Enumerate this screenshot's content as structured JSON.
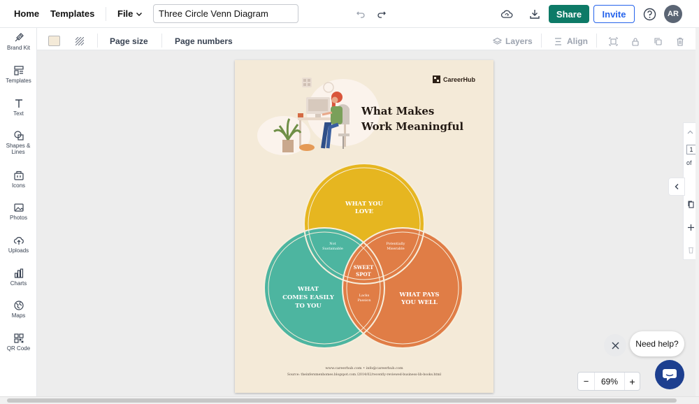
{
  "topbar": {
    "home": "Home",
    "templates": "Templates",
    "file": "File",
    "doc_title": "Three Circle Venn Diagram",
    "share": "Share",
    "invite": "Invite",
    "avatar": "AR"
  },
  "sidebar": {
    "items": [
      {
        "label": "Brand Kit",
        "icon": "brand-kit-icon"
      },
      {
        "label": "Templates",
        "icon": "templates-icon"
      },
      {
        "label": "Text",
        "icon": "text-icon"
      },
      {
        "label": "Shapes & Lines",
        "icon": "shapes-icon"
      },
      {
        "label": "Icons",
        "icon": "icons-icon"
      },
      {
        "label": "Photos",
        "icon": "photos-icon"
      },
      {
        "label": "Uploads",
        "icon": "uploads-icon"
      },
      {
        "label": "Charts",
        "icon": "charts-icon"
      },
      {
        "label": "Maps",
        "icon": "maps-icon"
      },
      {
        "label": "QR Code",
        "icon": "qr-code-icon"
      }
    ]
  },
  "subbar": {
    "page_size": "Page size",
    "page_numbers": "Page numbers",
    "layers": "Layers",
    "align": "Align",
    "bg_color": "#f4ead8"
  },
  "poster": {
    "brand": "CareerHub",
    "title_line1": "What Makes",
    "title_line2": "Work Meaningful",
    "circle_top": [
      "WHAT YOU",
      "LOVE"
    ],
    "circle_left": [
      "WHAT",
      "COMES EASILY",
      "TO YOU"
    ],
    "circle_right": [
      "WHAT PAYS",
      "YOU WELL"
    ],
    "overlap_top_left": [
      "Not",
      "Sustainable"
    ],
    "overlap_top_right": [
      "Potentially",
      "Miserable"
    ],
    "overlap_bottom": [
      "Lacks",
      "Passion"
    ],
    "center": [
      "SWEET",
      "SPOT"
    ],
    "footer_line1": "www.careerhub.com  •  info@careerhub.com",
    "footer_line2": "Source: theinfersmenhomes.blogspot.com /2014/02/recently-reviewed-business-lib-books.html",
    "colors": {
      "top": "#e6b620",
      "left": "#4db5a0",
      "right": "#e07d46"
    }
  },
  "rightpanel": {
    "page_number": "1",
    "of_label": "of"
  },
  "zoom": {
    "value": "69%",
    "minus": "−",
    "plus": "+"
  },
  "help": {
    "label": "Need help?"
  }
}
